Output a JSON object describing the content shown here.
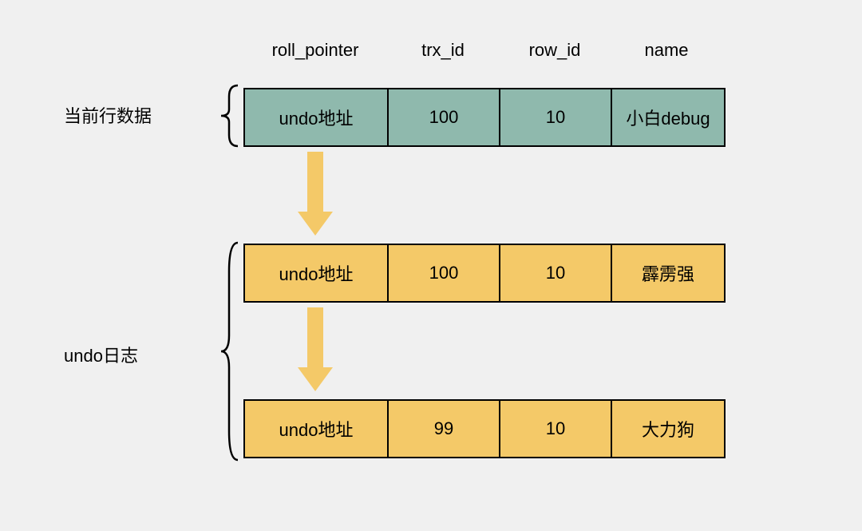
{
  "headers": {
    "roll_pointer": "roll_pointer",
    "trx_id": "trx_id",
    "row_id": "row_id",
    "name": "name"
  },
  "labels": {
    "current_row": "当前行数据",
    "undo_log": "undo日志"
  },
  "rows": {
    "current": {
      "roll_pointer": "undo地址",
      "trx_id": "100",
      "row_id": "10",
      "name": "小白debug"
    },
    "undo1": {
      "roll_pointer": "undo地址",
      "trx_id": "100",
      "row_id": "10",
      "name": "霹雳强"
    },
    "undo2": {
      "roll_pointer": "undo地址",
      "trx_id": "99",
      "row_id": "10",
      "name": "大力狗"
    }
  },
  "colors": {
    "teal": "#8fb9ad",
    "gold": "#f4c968",
    "background": "#f0f0f0"
  }
}
